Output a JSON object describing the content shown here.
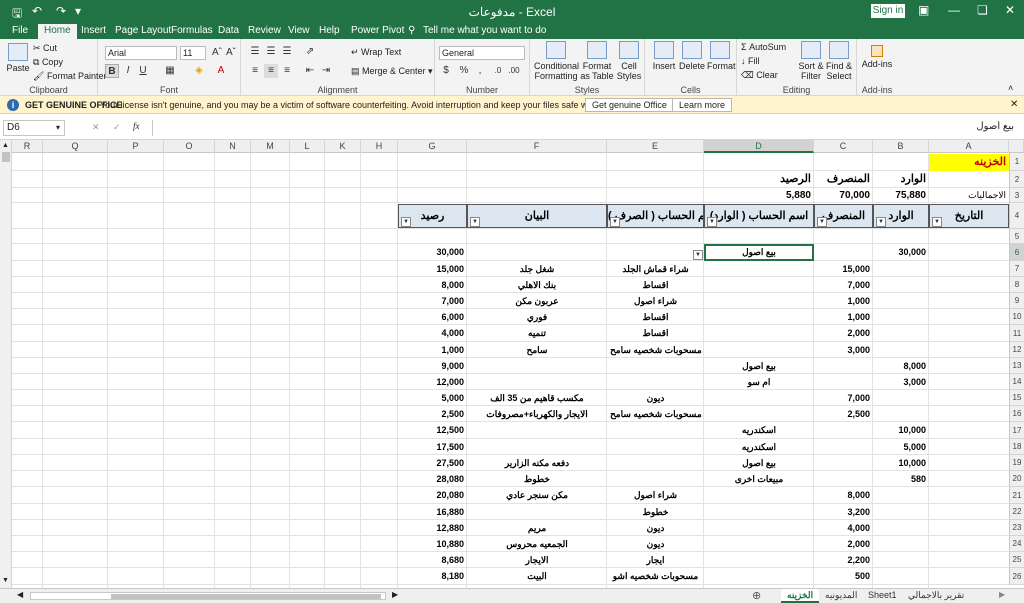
{
  "window": {
    "title": "مدفوعات - Excel",
    "signin": "Sign in"
  },
  "tabs": [
    "File",
    "Home",
    "Insert",
    "Page Layout",
    "Formulas",
    "Data",
    "Review",
    "View",
    "Help",
    "Power Pivot",
    "Tell me what you want to do"
  ],
  "ribbon": {
    "clipboard": {
      "paste": "Paste",
      "cut": "Cut",
      "copy": "Copy",
      "format_painter": "Format Painter",
      "label": "Clipboard"
    },
    "font": {
      "name": "Arial",
      "size": "11",
      "label": "Font"
    },
    "alignment": {
      "wrap": "Wrap Text",
      "merge": "Merge & Center",
      "label": "Alignment"
    },
    "number": {
      "format": "General",
      "label": "Number"
    },
    "styles": {
      "conditional": "Conditional Formatting",
      "table": "Format as Table",
      "cell": "Cell Styles",
      "label": "Styles"
    },
    "cells": {
      "insert": "Insert",
      "delete": "Delete",
      "format": "Format",
      "label": "Cells"
    },
    "editing": {
      "autosum": "AutoSum",
      "fill": "Fill",
      "clear": "Clear",
      "sort": "Sort & Filter",
      "find": "Find & Select",
      "label": "Editing"
    },
    "addins": {
      "addins": "Add-ins",
      "label": "Add-ins"
    }
  },
  "warning": {
    "title": "GET GENUINE OFFICE",
    "message": "Your license isn't genuine, and you may be a victim of software counterfeiting. Avoid interruption and keep your files safe with genuine Office today.",
    "btn1": "Get genuine Office",
    "btn2": "Learn more"
  },
  "formula_bar": {
    "name_box": "D6",
    "formula": "بيع اصول"
  },
  "columns": [
    "R",
    "Q",
    "P",
    "O",
    "N",
    "M",
    "L",
    "K",
    "H",
    "G",
    "F",
    "E",
    "D",
    "C",
    "B",
    "A"
  ],
  "rows": [
    "1",
    "2",
    "3",
    "4",
    "5",
    "6",
    "7",
    "8",
    "9",
    "10",
    "11",
    "12",
    "13",
    "14",
    "15",
    "16",
    "17",
    "18",
    "19",
    "20",
    "21",
    "22",
    "23",
    "24",
    "25",
    "26"
  ],
  "sheet": {
    "title": "الخزينه",
    "summary_in_label": "الوارد",
    "summary_out_label": "المنصرف",
    "summary_bal_label": "الرصيد",
    "totals_label": "الاجماليات",
    "total_in": "75,880",
    "total_out": "70,000",
    "total_bal": "5,880",
    "headers": {
      "date": "التاريخ",
      "in": "الوارد",
      "out": "المنصرف",
      "acct_in": "اسم الحساب ( الوارد)",
      "acct_out": "اسم الحساب ( الصرف )",
      "desc": "البيان",
      "bal": "رصيد"
    },
    "data": [
      {
        "in": "30,000",
        "out": "",
        "acct_in": "بيع اصول",
        "acct_out": "",
        "desc": "",
        "bal": "30,000"
      },
      {
        "in": "",
        "out": "15,000",
        "acct_in": "",
        "acct_out": "شراء قماش الجلد",
        "desc": "شغل جلد",
        "bal": "15,000"
      },
      {
        "in": "",
        "out": "7,000",
        "acct_in": "",
        "acct_out": "اقساط",
        "desc": "بنك الاهلي",
        "bal": "8,000"
      },
      {
        "in": "",
        "out": "1,000",
        "acct_in": "",
        "acct_out": "شراء اصول",
        "desc": "عربون مكن",
        "bal": "7,000"
      },
      {
        "in": "",
        "out": "1,000",
        "acct_in": "",
        "acct_out": "اقساط",
        "desc": "فوري",
        "bal": "6,000"
      },
      {
        "in": "",
        "out": "2,000",
        "acct_in": "",
        "acct_out": "اقساط",
        "desc": "تنميه",
        "bal": "4,000"
      },
      {
        "in": "",
        "out": "3,000",
        "acct_in": "",
        "acct_out": "مسحوبات شخصيه سامح",
        "desc": "سامح",
        "bal": "1,000"
      },
      {
        "in": "8,000",
        "out": "",
        "acct_in": "بيع اصول",
        "acct_out": "",
        "desc": "",
        "bal": "9,000"
      },
      {
        "in": "3,000",
        "out": "",
        "acct_in": "ام سو",
        "acct_out": "",
        "desc": "",
        "bal": "12,000"
      },
      {
        "in": "",
        "out": "7,000",
        "acct_in": "",
        "acct_out": "ديون",
        "desc": "مكسب قاهيم من 35 الف",
        "bal": "5,000"
      },
      {
        "in": "",
        "out": "2,500",
        "acct_in": "",
        "acct_out": "مسحوبات شخصيه سامح",
        "desc": "الايجار والكهرباء+مصروفات",
        "bal": "2,500"
      },
      {
        "in": "10,000",
        "out": "",
        "acct_in": "اسكندريه",
        "acct_out": "",
        "desc": "",
        "bal": "12,500"
      },
      {
        "in": "5,000",
        "out": "",
        "acct_in": "اسكندريه",
        "acct_out": "",
        "desc": "",
        "bal": "17,500"
      },
      {
        "in": "10,000",
        "out": "",
        "acct_in": "بيع اصول",
        "acct_out": "",
        "desc": "دفعه مكنه الزارير",
        "bal": "27,500"
      },
      {
        "in": "580",
        "out": "",
        "acct_in": "مبيعات اخرى",
        "acct_out": "",
        "desc": "خطوط",
        "bal": "28,080"
      },
      {
        "in": "",
        "out": "8,000",
        "acct_in": "",
        "acct_out": "شراء اصول",
        "desc": "مكن سنجر عادي",
        "bal": "20,080"
      },
      {
        "in": "",
        "out": "3,200",
        "acct_in": "",
        "acct_out": "خطوط",
        "desc": "",
        "bal": "16,880"
      },
      {
        "in": "",
        "out": "4,000",
        "acct_in": "",
        "acct_out": "ديون",
        "desc": "مريم",
        "bal": "12,880"
      },
      {
        "in": "",
        "out": "2,000",
        "acct_in": "",
        "acct_out": "ديون",
        "desc": "الجمعيه محروس",
        "bal": "10,880"
      },
      {
        "in": "",
        "out": "2,200",
        "acct_in": "",
        "acct_out": "ايجار",
        "desc": "الايجار",
        "bal": "8,680"
      },
      {
        "in": "",
        "out": "500",
        "acct_in": "",
        "acct_out": "مسحوبات شخصيه اشو",
        "desc": "البيت",
        "bal": "8,180"
      }
    ]
  },
  "sheet_tabs": [
    "الخزينه",
    "المديونيه",
    "Sheet1",
    "تقرير بالاجمالي"
  ]
}
